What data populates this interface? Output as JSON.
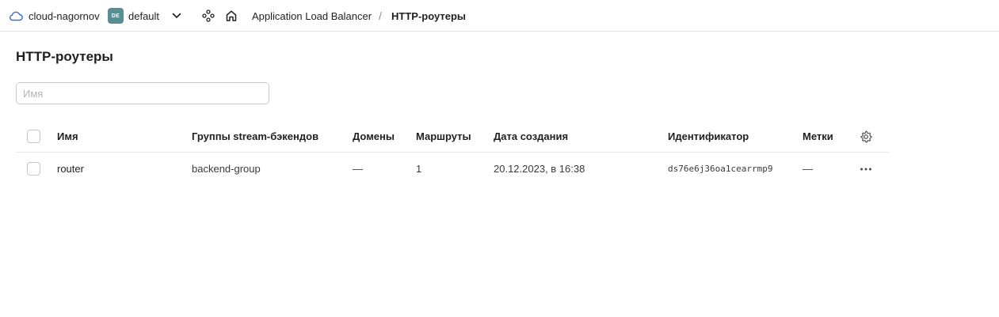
{
  "topbar": {
    "cloud_name": "cloud-nagornov",
    "folder_badge": "DE",
    "folder_name": "default",
    "breadcrumb": {
      "service": "Application Load Balancer",
      "separator": "/",
      "current": "HTTP-роутеры"
    },
    "icons": {
      "cloud": "cloud-icon",
      "chevron": "chevron-down-icon",
      "services": "services-icon",
      "home": "home-icon"
    }
  },
  "page": {
    "title": "HTTP-роутеры"
  },
  "search": {
    "placeholder": "Имя",
    "value": ""
  },
  "table": {
    "headers": {
      "name": "Имя",
      "groups": "Группы stream-бэкендов",
      "domains": "Домены",
      "routes": "Маршруты",
      "created": "Дата создания",
      "id": "Идентификатор",
      "labels": "Метки"
    },
    "rows": [
      {
        "name": "router",
        "groups": "backend-group",
        "domains": "—",
        "routes": "1",
        "created": "20.12.2023, в 16:38",
        "id": "ds76e6j36oa1cearrmp9",
        "labels": "—"
      }
    ]
  },
  "colors": {
    "accent_link": "#3b6fd6",
    "folder_badge_bg": "#5a8e93",
    "cloud_icon": "#3b6fd6"
  }
}
